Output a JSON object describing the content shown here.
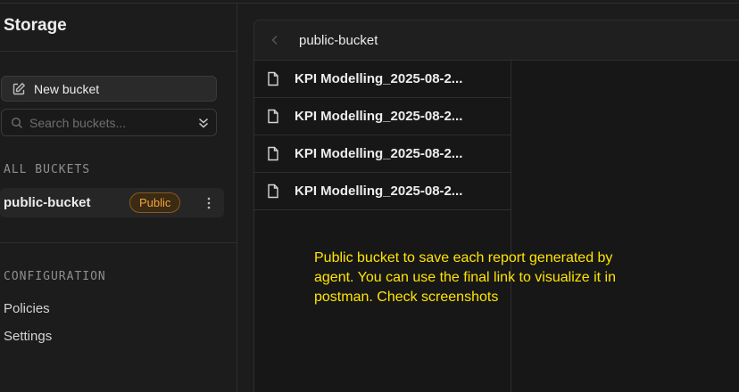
{
  "sidebar": {
    "title": "Storage",
    "new_bucket_label": "New bucket",
    "search_placeholder": "Search buckets...",
    "all_buckets_label": "ALL BUCKETS",
    "buckets": [
      {
        "name": "public-bucket",
        "badge": "Public"
      }
    ],
    "configuration_label": "CONFIGURATION",
    "config_items": [
      "Policies",
      "Settings"
    ]
  },
  "explorer": {
    "bucket_title": "public-bucket",
    "files": [
      "KPI Modelling_2025-08-2...",
      "KPI Modelling_2025-08-2...",
      "KPI Modelling_2025-08-2...",
      "KPI Modelling_2025-08-2..."
    ]
  },
  "annotation": {
    "text": "Public bucket to save each report generated by agent. You can use the final link to visualize it in postman. Check screenshots"
  },
  "colors": {
    "badge_text": "#f1a43a",
    "annotation": "#ffe400",
    "background": "#1c1c1c"
  }
}
